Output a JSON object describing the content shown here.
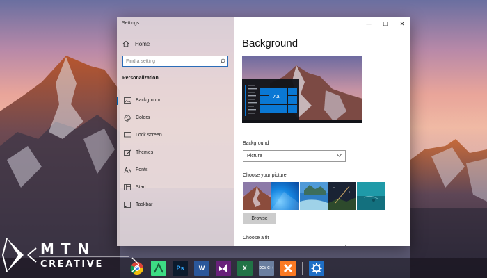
{
  "window": {
    "title": "Settings",
    "controls": [
      "minimize",
      "maximize",
      "close"
    ],
    "minimize_glyph": "—",
    "maximize_glyph": "☐",
    "close_glyph": "✕"
  },
  "sidebar": {
    "home_label": "Home",
    "home_icon": "home-icon",
    "search_placeholder": "Find a setting",
    "search_icon": "search-icon",
    "section_title": "Personalization",
    "items": [
      {
        "label": "Background",
        "icon": "image-icon",
        "active": true
      },
      {
        "label": "Colors",
        "icon": "palette-icon",
        "active": false
      },
      {
        "label": "Lock screen",
        "icon": "monitor-icon",
        "active": false
      },
      {
        "label": "Themes",
        "icon": "brush-icon",
        "active": false
      },
      {
        "label": "Fonts",
        "icon": "font-icon",
        "active": false
      },
      {
        "label": "Start",
        "icon": "start-grid-icon",
        "active": false
      },
      {
        "label": "Taskbar",
        "icon": "taskbar-icon",
        "active": false
      }
    ]
  },
  "main": {
    "title": "Background",
    "preview_tile_label": "Aa",
    "background_label": "Background",
    "background_value": "Picture",
    "choose_picture_label": "Choose your picture",
    "browse_label": "Browse",
    "choose_fit_label": "Choose a fit"
  },
  "taskbar": {
    "icons": [
      "chrome-icon",
      "android-studio-icon",
      "photoshop-icon",
      "word-icon",
      "visual-studio-icon",
      "excel-icon",
      "dev-c-icon",
      "xampp-icon",
      "settings-gear-icon"
    ],
    "photoshop_text": "Ps",
    "word_text": "W",
    "excel_text": "X",
    "devc_text": "DEV C++"
  },
  "watermark": {
    "line1": "MTN",
    "line2": "CREATIVE"
  },
  "colors": {
    "accent": "#0063b1",
    "taskbar_active": "#1f6fc6"
  }
}
